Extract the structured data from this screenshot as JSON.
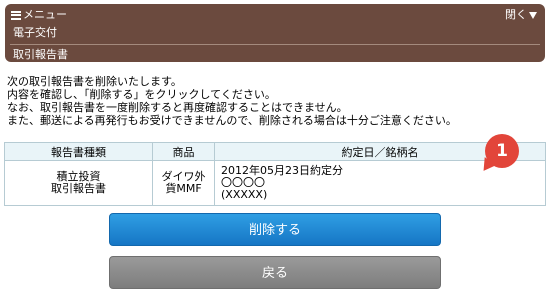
{
  "header": {
    "menu_label": "メニュー",
    "close_label": "閉く",
    "sub_title": "電子交付",
    "breadcrumb": "取引報告書"
  },
  "message": {
    "lines": [
      "次の取引報告書を削除いたします。",
      "内容を確認し、「削除する」をクリックしてください。",
      "なお、取引報告書を一度削除すると再度確認することはできません。",
      "また、郵送による再発行もお受けできませんので、削除される場合は十分ご注意ください。"
    ]
  },
  "table": {
    "headers": [
      "報告書種類",
      "商品",
      "約定日／銘柄名"
    ],
    "row": {
      "type_lines": [
        "積立投資",
        "取引報告書"
      ],
      "product_lines": [
        "ダイワ外",
        "貨MMF"
      ],
      "date_lines": [
        "2012年05月23日約定分",
        "〇〇〇〇",
        "(XXXXX)"
      ]
    }
  },
  "badge": "1",
  "buttons": {
    "delete_label": "削除する",
    "back_label": "戻る"
  },
  "colors": {
    "header_bg": "#6b4a3e",
    "table_header_bg": "#e9f4f8",
    "delete_button": "#1f86d3",
    "back_button": "#8c8c8c",
    "badge": "#e2453a"
  }
}
